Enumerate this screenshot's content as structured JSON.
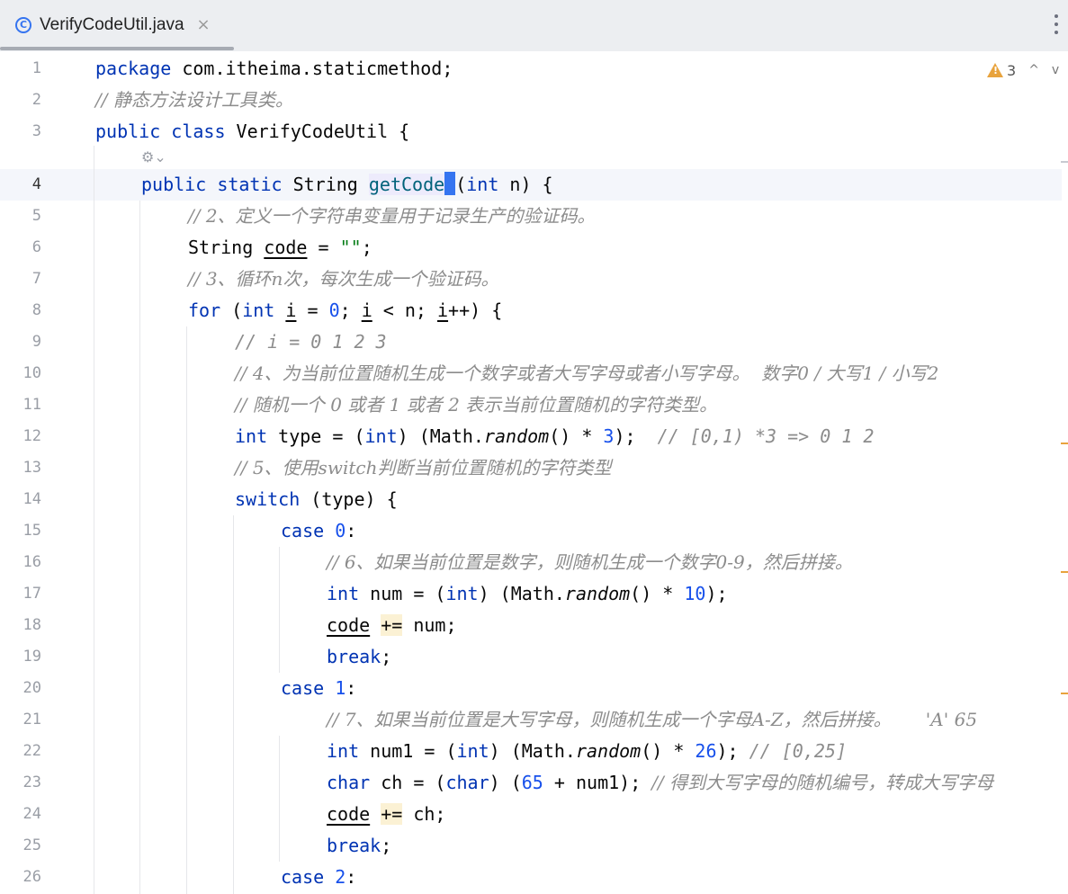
{
  "tab": {
    "icon": "C",
    "file_name": "VerifyCodeUtil.java",
    "close": "×"
  },
  "inspection": {
    "warning_count": "3",
    "prev_arrow": "^",
    "next_arrow": "v"
  },
  "gen_icon_glyph": "⚙⌄",
  "line_numbers": [
    "1",
    "2",
    "3",
    "4",
    "5",
    "6",
    "7",
    "8",
    "9",
    "10",
    "11",
    "12",
    "13",
    "14",
    "15",
    "16",
    "17",
    "18",
    "19",
    "20",
    "21",
    "22",
    "23",
    "24",
    "25",
    "26"
  ],
  "code": {
    "l1": {
      "kw": "package",
      "rest": " com.itheima.staticmethod;"
    },
    "l2": {
      "cmt": "// 静态方法设计工具类。"
    },
    "l3": {
      "kw1": "public",
      "kw2": "class",
      "rest": " VerifyCodeUtil {"
    },
    "l4": {
      "pre_a": "pu",
      "pre_b": "blic",
      "kw2": "static",
      "type": " String ",
      "fn_a": "getCode",
      "sig_kw": "int",
      "sig_rest": " n) {"
    },
    "l5": {
      "cmt": "// 2、定义一个字符串变量用于记录生产的验证码。"
    },
    "l6": {
      "type": "String ",
      "var": "code",
      "eq": " = ",
      "str": "\"\"",
      "end": ";"
    },
    "l7": {
      "cmt": "// 3、循环n次，每次生成一个验证码。"
    },
    "l8": {
      "kw": "for",
      "p1": " (",
      "kw2": "int",
      "v1": " ",
      "i1": "i",
      "eq": " = ",
      "n0": "0",
      "semi": "; ",
      "i2": "i",
      "lt": " < n; ",
      "i3": "i",
      "inc": "++) {"
    },
    "l9": {
      "cmt": "// i = 0 1 2 3"
    },
    "l10": {
      "cmt": "// 4、为当前位置随机生成一个数字或者大写字母或者小写字母。  数字0 / 大写1 / 小写2"
    },
    "l11": {
      "cmt": "// 随机一个 0 或者 1 或者 2 表示当前位置随机的字符类型。"
    },
    "l12": {
      "kw": "int",
      "a": " type = (",
      "kw2": "int",
      "b": ") (Math.",
      "m": "random",
      "c": "() * ",
      "n": "3",
      "d": ");  ",
      "cmt": "// [0,1) *3 => 0 1 2"
    },
    "l13": {
      "cmt": "// 5、使用switch判断当前位置随机的字符类型"
    },
    "l14": {
      "kw": "switch",
      "rest": " (type) {"
    },
    "l15": {
      "kw": "case",
      "sp": " ",
      "n": "0",
      "end": ":"
    },
    "l16": {
      "cmt": "// 6、如果当前位置是数字，则随机生成一个数字0-9，然后拼接。"
    },
    "l17": {
      "kw": "int",
      "a": " num = (",
      "kw2": "int",
      "b": ") (Math.",
      "m": "random",
      "c": "() * ",
      "n": "10",
      "d": ");"
    },
    "l18": {
      "var": "code",
      "sp": " ",
      "op": "+=",
      "rest": " num;"
    },
    "l19": {
      "kw": "break",
      "end": ";"
    },
    "l20": {
      "kw": "case",
      "sp": " ",
      "n": "1",
      "end": ":"
    },
    "l21": {
      "cmt": "// 7、如果当前位置是大写字母，则随机生成一个字母A-Z，然后拼接。      'A' 65"
    },
    "l22": {
      "kw": "int",
      "a": " num1 = (",
      "kw2": "int",
      "b": ") (Math.",
      "m": "random",
      "c": "() * ",
      "n": "26",
      "d": "); ",
      "cmt": "// [0,25]"
    },
    "l23": {
      "kw": "char",
      "a": " ch = (",
      "kw2": "char",
      "b": ") (",
      "n": "65",
      "c": " + num1); ",
      "cmt": "// 得到大写字母的随机编号，转成大写字母"
    },
    "l24": {
      "var": "code",
      "sp": " ",
      "op": "+=",
      "rest": " ch;"
    },
    "l25": {
      "kw": "break",
      "end": ";"
    },
    "l26": {
      "kw": "case",
      "sp": " ",
      "n": "2",
      "end": ":"
    }
  },
  "colors": {
    "keyword": "#0033b3",
    "string": "#067d17",
    "number": "#1750eb",
    "comment": "#8c8c8c",
    "method": "#00627a",
    "warning": "#e8a33d",
    "caret": "#3574f0"
  }
}
